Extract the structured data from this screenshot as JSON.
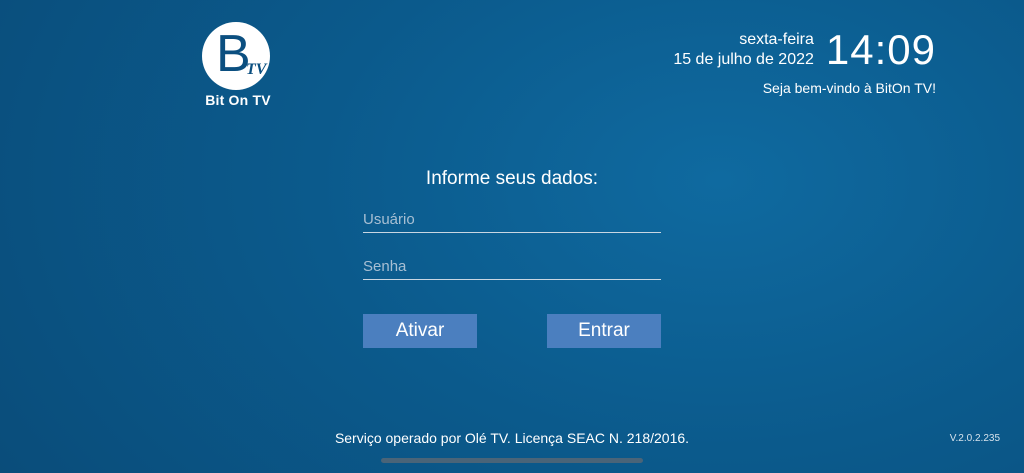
{
  "app": {
    "logo_letter": "B",
    "logo_tv": "TV",
    "brand_name": "Bit On TV"
  },
  "header": {
    "weekday": "sexta-feira",
    "date": "15 de julho de 2022",
    "time": "14:09",
    "welcome": "Seja bem-vindo à BitOn TV!"
  },
  "login": {
    "title": "Informe seus dados:",
    "username_placeholder": "Usuário",
    "username_value": "",
    "password_placeholder": "Senha",
    "password_value": "",
    "activate_label": "Ativar",
    "enter_label": "Entrar"
  },
  "footer": {
    "notice": "Serviço operado por Olé TV. Licença SEAC N. 218/2016.",
    "version": "V.2.0.2.235"
  },
  "colors": {
    "background": "#0b5a8c",
    "button": "#4b7fbf",
    "logo_blue": "#0b4f80"
  }
}
